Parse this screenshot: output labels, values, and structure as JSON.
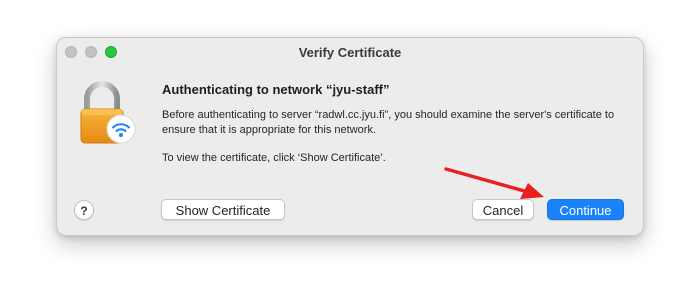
{
  "window": {
    "title": "Verify Certificate"
  },
  "dialog": {
    "heading": "Authenticating to network “jyu-staff”",
    "paragraph1": "Before authenticating to server “radwl.cc.jyu.fi”, you should examine the server's certificate to ensure that it is appropriate for this network.",
    "paragraph2": "To view the certificate, click ‘Show Certificate’.",
    "icon": "padlock-wifi-icon"
  },
  "buttons": {
    "help": "?",
    "show_certificate": "Show Certificate",
    "cancel": "Cancel",
    "continue": "Continue"
  },
  "colors": {
    "accent": "#1a82fb",
    "annotation_arrow": "#e8201f",
    "zoom_button": "#2ac840"
  },
  "annotation": {
    "type": "arrow",
    "points_to": "continue-button"
  }
}
